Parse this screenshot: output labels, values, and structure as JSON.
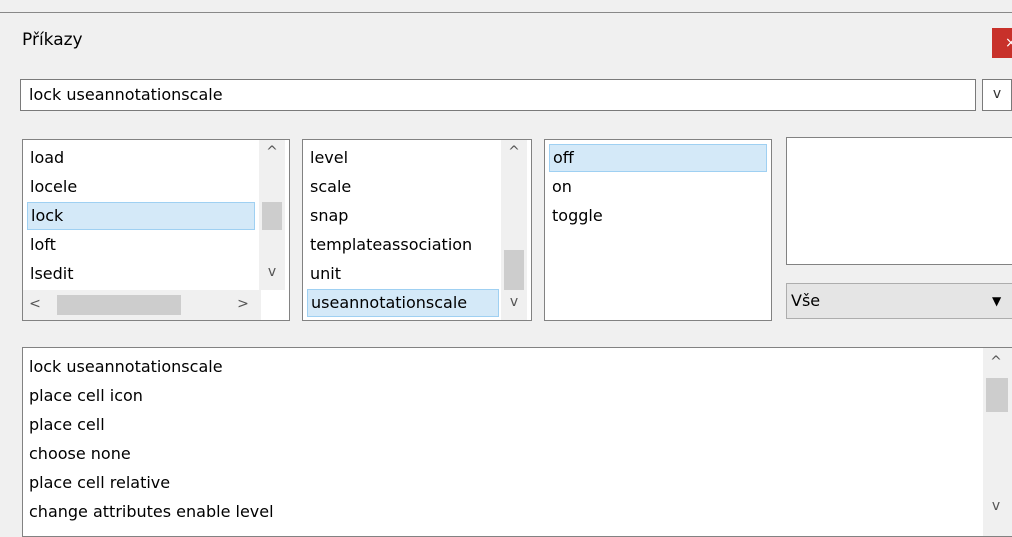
{
  "window": {
    "title": "Příkazy",
    "close_label": "×"
  },
  "command_input": {
    "value": "lock useannotationscale",
    "dropdown_label": "v"
  },
  "keywords_list": {
    "items": [
      "load",
      "locele",
      "lock",
      "loft",
      "lsedit"
    ],
    "selected": "lock",
    "scroll_up": "^",
    "scroll_down": "v",
    "scroll_left": "<",
    "scroll_right": ">"
  },
  "subkeywords_list": {
    "items": [
      "level",
      "scale",
      "snap",
      "templateassociation",
      "unit",
      "useannotationscale"
    ],
    "selected": "useannotationscale",
    "scroll_up": "^",
    "scroll_down": "v"
  },
  "options_list": {
    "items": [
      "off",
      "on",
      "toggle"
    ],
    "selected": "off"
  },
  "filter_combo": {
    "value": "Vše",
    "arrow": "▼"
  },
  "history_list": {
    "items": [
      "lock useannotationscale",
      "place cell icon",
      "place cell",
      "choose none",
      "place cell relative",
      "change attributes enable level"
    ],
    "scroll_up": "^",
    "scroll_down": "v"
  }
}
